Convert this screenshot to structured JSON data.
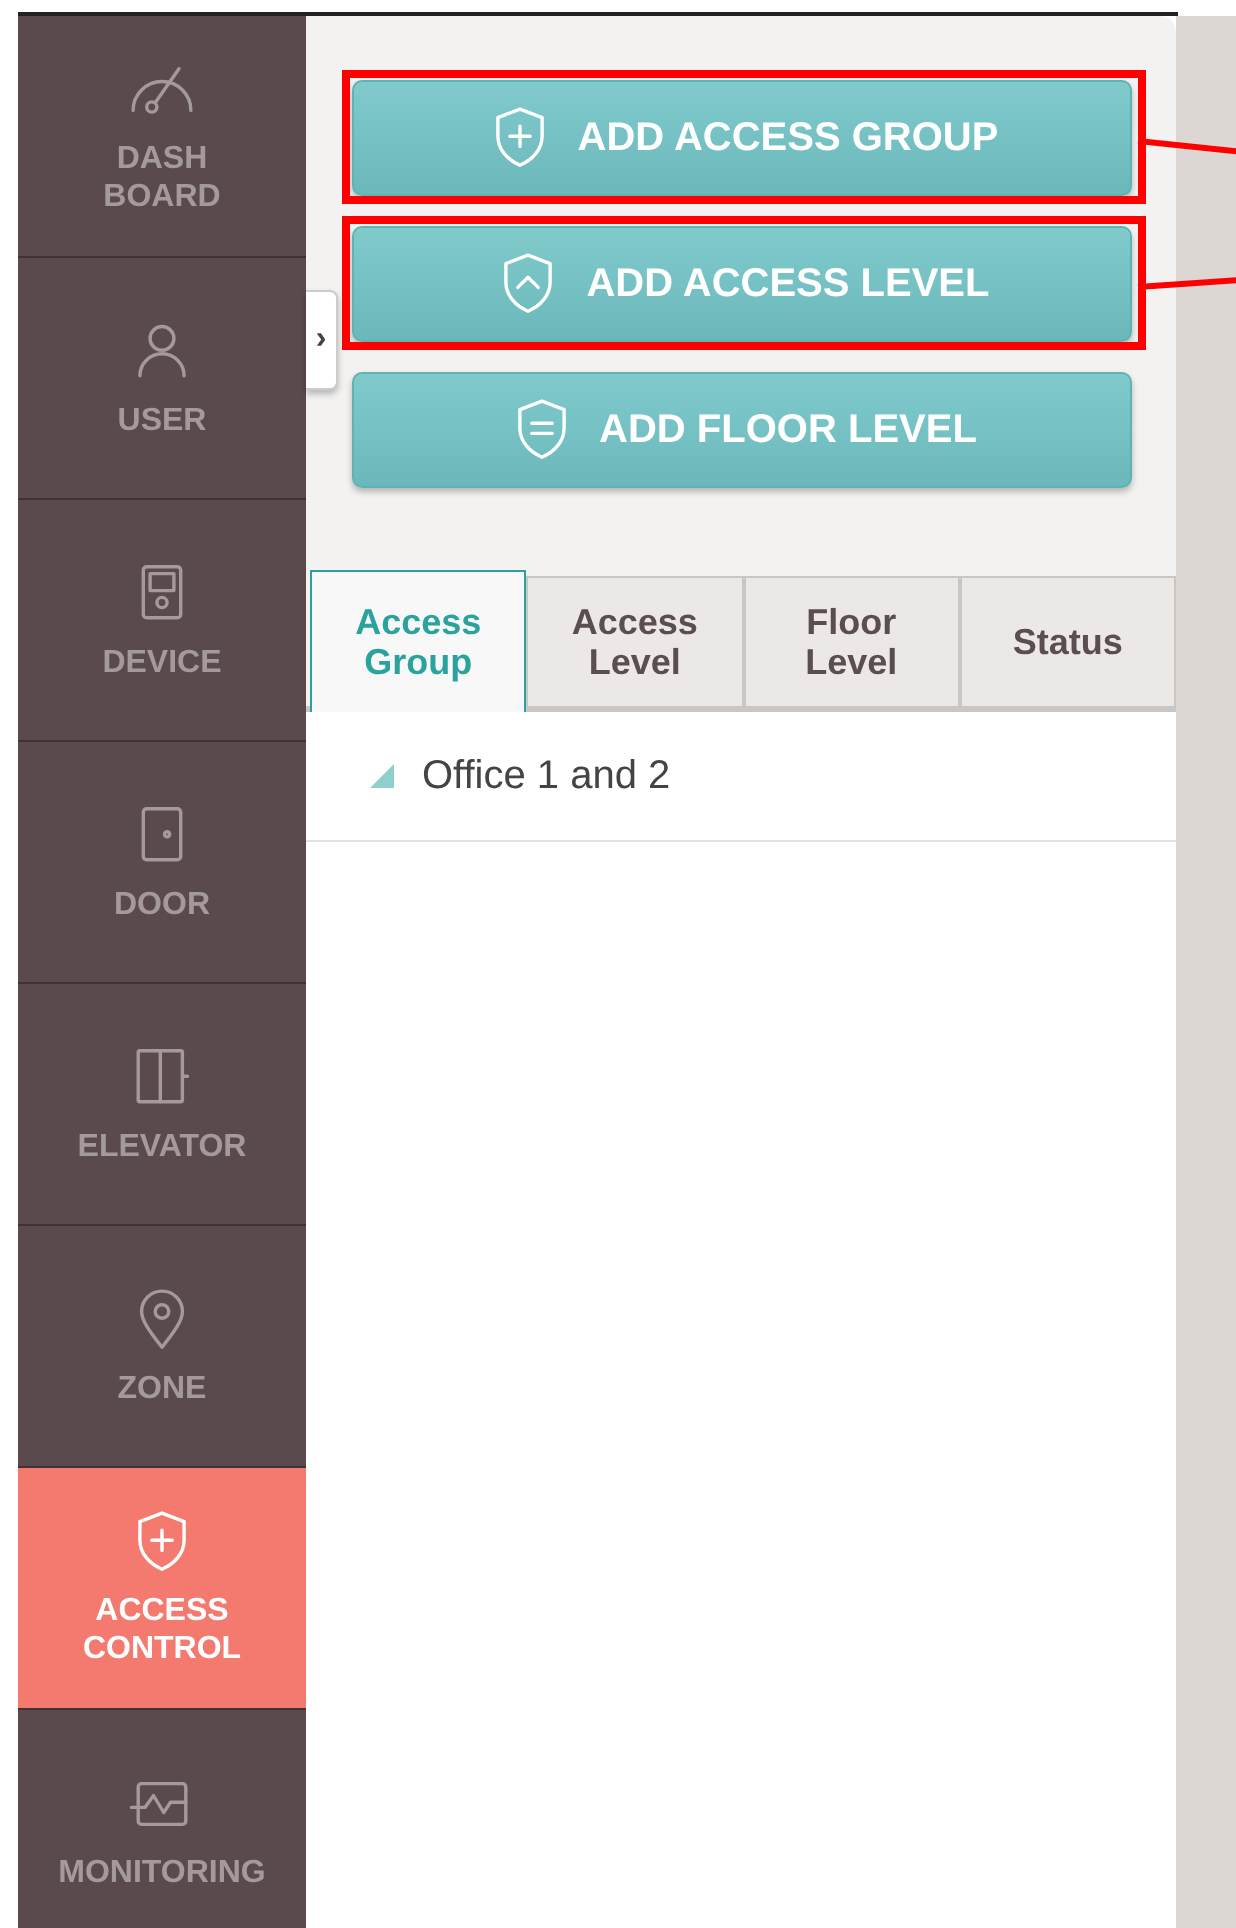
{
  "sidebar": {
    "items": [
      {
        "label": "DASH BOARD",
        "selected": false
      },
      {
        "label": "USER",
        "selected": false
      },
      {
        "label": "DEVICE",
        "selected": false
      },
      {
        "label": "DOOR",
        "selected": false
      },
      {
        "label": "ELEVATOR",
        "selected": false
      },
      {
        "label": "ZONE",
        "selected": false
      },
      {
        "label": "ACCESS CONTROL",
        "selected": true
      },
      {
        "label": "MONITORING",
        "selected": false
      }
    ]
  },
  "collapse_handle": {
    "label": "›"
  },
  "actions": [
    {
      "label": "ADD ACCESS GROUP",
      "highlighted": true
    },
    {
      "label": "ADD ACCESS LEVEL",
      "highlighted": true
    },
    {
      "label": "ADD FLOOR LEVEL",
      "highlighted": false
    }
  ],
  "tabs": [
    {
      "label": "Access Group",
      "selected": true
    },
    {
      "label": "Access Level",
      "selected": false
    },
    {
      "label": "Floor Level",
      "selected": false
    },
    {
      "label": "Status",
      "selected": false
    }
  ],
  "tree": [
    {
      "label": "Office 1 and 2",
      "expanded": true
    }
  ]
}
